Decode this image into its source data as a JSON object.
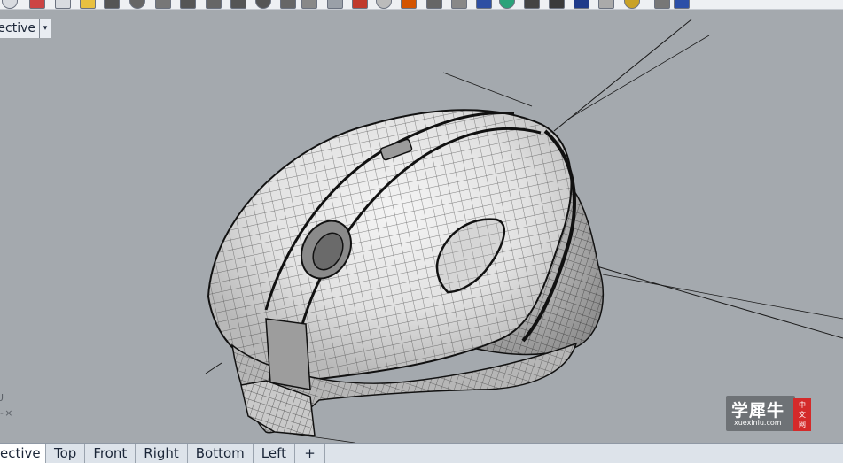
{
  "toolbar": {
    "icons": [
      "new-file-icon",
      "cut-icon",
      "copy-icon",
      "folder-icon",
      "undo-icon",
      "curve-icon",
      "arc-icon",
      "point-icon",
      "polyline-icon",
      "circle-icon",
      "zoom-icon",
      "zoom-window-icon",
      "grid-icon",
      "rectangle-icon",
      "eraser-icon",
      "sphere-icon",
      "text-icon",
      "pen-icon",
      "layer-icon",
      "shade-icon",
      "render-icon",
      "material-icon",
      "lights-icon",
      "env-icon",
      "world-icon",
      "settings-icon",
      "options-icon",
      "help-icon"
    ]
  },
  "viewport": {
    "name": "ective",
    "dropdown_glyph": "▾"
  },
  "axis": {
    "u_label": "U",
    "x_label": "~×"
  },
  "watermark": {
    "brand": "学犀牛",
    "seal_chars": [
      "中",
      "文",
      "网"
    ],
    "url": "xuexiniu.com"
  },
  "tabs": [
    {
      "label": "ective",
      "active": true
    },
    {
      "label": "Top",
      "active": false
    },
    {
      "label": "Front",
      "active": false
    },
    {
      "label": "Right",
      "active": false
    },
    {
      "label": "Bottom",
      "active": false
    },
    {
      "label": "Left",
      "active": false
    }
  ],
  "add_tab_glyph": "+"
}
